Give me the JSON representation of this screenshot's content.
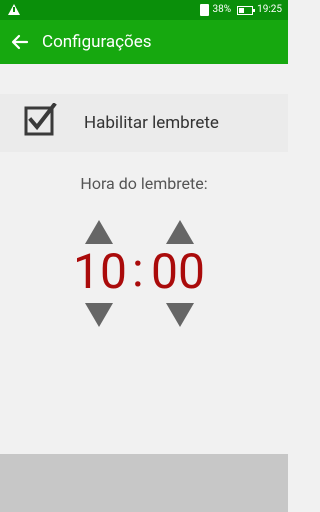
{
  "status_bar": {
    "battery": "38%",
    "time": "19:25"
  },
  "app_bar": {
    "title": "Configurações"
  },
  "settings": {
    "enable_label": "Habilitar lembrete",
    "enabled": true,
    "reminder_label": "Hora do lembrete:",
    "hour": "10",
    "separator": ":",
    "minute": "00"
  },
  "colors": {
    "status_bar": "#0a8f0a",
    "app_bar": "#16a80f",
    "time_text": "#aa0b0b"
  },
  "icons": {
    "warning": "warning-icon",
    "back": "arrow-left-icon",
    "check": "checkbox-checked-icon",
    "up": "arrow-up-icon",
    "down": "arrow-down-icon"
  }
}
